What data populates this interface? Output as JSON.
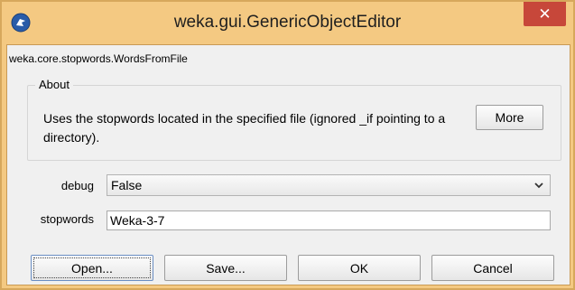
{
  "window": {
    "title": "weka.gui.GenericObjectEditor",
    "close_label": "✕"
  },
  "editor": {
    "class_name": "weka.core.stopwords.WordsFromFile"
  },
  "about": {
    "legend": "About",
    "text": "Uses the stopwords located in the specified file (ignored _if pointing to a directory).",
    "more_label": "More"
  },
  "properties": {
    "debug": {
      "label": "debug",
      "value": "False"
    },
    "stopwords": {
      "label": "stopwords",
      "value": "Weka-3-7"
    }
  },
  "buttons": {
    "open": "Open...",
    "save": "Save...",
    "ok": "OK",
    "cancel": "Cancel"
  },
  "icons": {
    "app": "weka-bird-icon",
    "dropdown": "chevron-down-icon"
  },
  "colors": {
    "titlebar": "#f4c982",
    "close": "#c7473a"
  }
}
